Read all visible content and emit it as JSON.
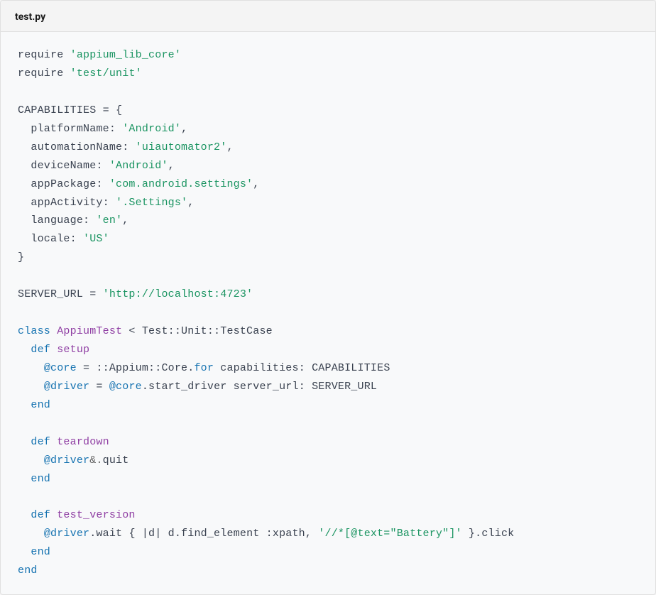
{
  "header": {
    "filename": "test.py"
  },
  "code": {
    "tokens": [
      {
        "t": "require ",
        "c": ""
      },
      {
        "t": "'appium_lib_core'",
        "c": "tok-str"
      },
      {
        "t": "\n",
        "c": ""
      },
      {
        "t": "require ",
        "c": ""
      },
      {
        "t": "'test/unit'",
        "c": "tok-str"
      },
      {
        "t": "\n\n",
        "c": ""
      },
      {
        "t": "CAPABILITIES = {\n",
        "c": ""
      },
      {
        "t": "  platformName: ",
        "c": ""
      },
      {
        "t": "'Android'",
        "c": "tok-str"
      },
      {
        "t": ",\n",
        "c": ""
      },
      {
        "t": "  automationName: ",
        "c": ""
      },
      {
        "t": "'uiautomator2'",
        "c": "tok-str"
      },
      {
        "t": ",\n",
        "c": ""
      },
      {
        "t": "  deviceName: ",
        "c": ""
      },
      {
        "t": "'Android'",
        "c": "tok-str"
      },
      {
        "t": ",\n",
        "c": ""
      },
      {
        "t": "  appPackage: ",
        "c": ""
      },
      {
        "t": "'com.android.settings'",
        "c": "tok-str"
      },
      {
        "t": ",\n",
        "c": ""
      },
      {
        "t": "  appActivity: ",
        "c": ""
      },
      {
        "t": "'.Settings'",
        "c": "tok-str"
      },
      {
        "t": ",\n",
        "c": ""
      },
      {
        "t": "  language: ",
        "c": ""
      },
      {
        "t": "'en'",
        "c": "tok-str"
      },
      {
        "t": ",\n",
        "c": ""
      },
      {
        "t": "  locale: ",
        "c": ""
      },
      {
        "t": "'US'",
        "c": "tok-str"
      },
      {
        "t": "\n",
        "c": ""
      },
      {
        "t": "}\n\n",
        "c": ""
      },
      {
        "t": "SERVER_URL = ",
        "c": ""
      },
      {
        "t": "'http://localhost:4723'",
        "c": "tok-str"
      },
      {
        "t": "\n\n",
        "c": ""
      },
      {
        "t": "class",
        "c": "tok-kw"
      },
      {
        "t": " ",
        "c": ""
      },
      {
        "t": "AppiumTest",
        "c": "tok-cls"
      },
      {
        "t": " < Test::Unit::TestCase\n",
        "c": ""
      },
      {
        "t": "  ",
        "c": ""
      },
      {
        "t": "def",
        "c": "tok-kw"
      },
      {
        "t": " ",
        "c": ""
      },
      {
        "t": "setup",
        "c": "tok-def"
      },
      {
        "t": "\n",
        "c": ""
      },
      {
        "t": "    ",
        "c": ""
      },
      {
        "t": "@core",
        "c": "tok-at"
      },
      {
        "t": " = ::Appium::Core.",
        "c": ""
      },
      {
        "t": "for",
        "c": "tok-kw"
      },
      {
        "t": " capabilities: CAPABILITIES\n",
        "c": ""
      },
      {
        "t": "    ",
        "c": ""
      },
      {
        "t": "@driver",
        "c": "tok-at"
      },
      {
        "t": " = ",
        "c": ""
      },
      {
        "t": "@core",
        "c": "tok-at"
      },
      {
        "t": ".start_driver server_url: SERVER_URL\n",
        "c": ""
      },
      {
        "t": "  ",
        "c": ""
      },
      {
        "t": "end",
        "c": "tok-kw"
      },
      {
        "t": "\n\n",
        "c": ""
      },
      {
        "t": "  ",
        "c": ""
      },
      {
        "t": "def",
        "c": "tok-kw"
      },
      {
        "t": " ",
        "c": ""
      },
      {
        "t": "teardown",
        "c": "tok-def"
      },
      {
        "t": "\n",
        "c": ""
      },
      {
        "t": "    ",
        "c": ""
      },
      {
        "t": "@driver",
        "c": "tok-at"
      },
      {
        "t": "&.",
        "c": "tok-op"
      },
      {
        "t": "quit\n",
        "c": ""
      },
      {
        "t": "  ",
        "c": ""
      },
      {
        "t": "end",
        "c": "tok-kw"
      },
      {
        "t": "\n\n",
        "c": ""
      },
      {
        "t": "  ",
        "c": ""
      },
      {
        "t": "def",
        "c": "tok-kw"
      },
      {
        "t": " ",
        "c": ""
      },
      {
        "t": "test_version",
        "c": "tok-def"
      },
      {
        "t": "\n",
        "c": ""
      },
      {
        "t": "    ",
        "c": ""
      },
      {
        "t": "@driver",
        "c": "tok-at"
      },
      {
        "t": ".wait { |d| d.find_element :xpath, ",
        "c": ""
      },
      {
        "t": "'//*[@text=\"Battery\"]'",
        "c": "tok-str"
      },
      {
        "t": " }.click\n",
        "c": ""
      },
      {
        "t": "  ",
        "c": ""
      },
      {
        "t": "end",
        "c": "tok-kw"
      },
      {
        "t": "\n",
        "c": ""
      },
      {
        "t": "end",
        "c": "tok-kw"
      }
    ]
  }
}
